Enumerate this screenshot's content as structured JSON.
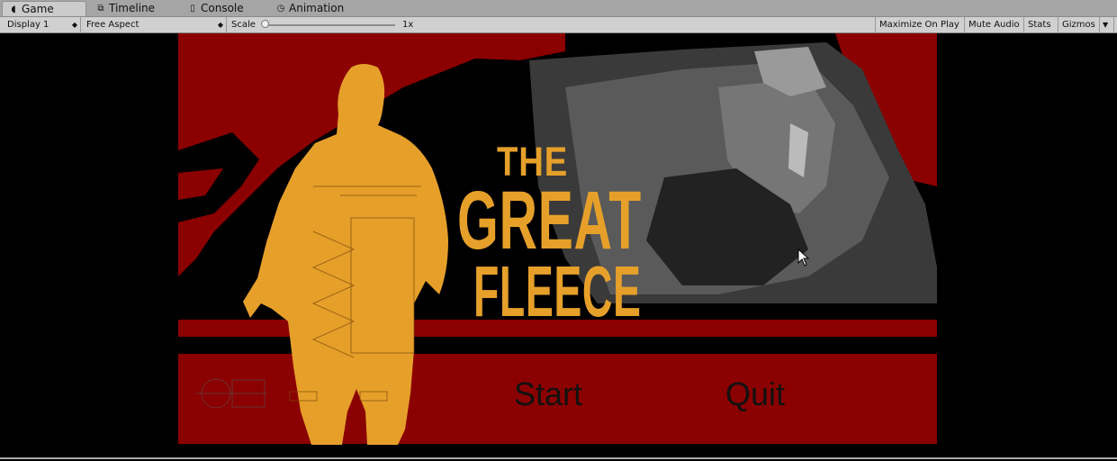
{
  "tabs": [
    {
      "label": "Game",
      "icon": "pacman-icon"
    },
    {
      "label": "Timeline",
      "icon": "timeline-icon"
    },
    {
      "label": "Console",
      "icon": "console-icon"
    },
    {
      "label": "Animation",
      "icon": "clock-icon"
    }
  ],
  "toolbar": {
    "display": "Display 1",
    "aspect": "Free Aspect",
    "scale_label": "Scale",
    "scale_value": "1x",
    "maximize": "Maximize On Play",
    "mute": "Mute Audio",
    "stats": "Stats",
    "gizmos": "Gizmos"
  },
  "game": {
    "title_line1": "THE",
    "title_line2": "GREAT",
    "title_line3": "FLEECE",
    "start_label": "Start",
    "quit_label": "Quit"
  },
  "colors": {
    "red": "#8b0000",
    "orange": "#e6a02a",
    "background": "#000000"
  }
}
